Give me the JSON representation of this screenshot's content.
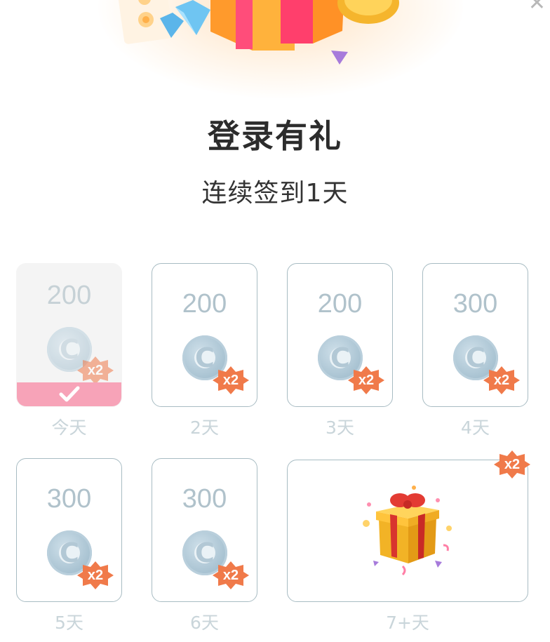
{
  "dialog": {
    "title": "登录有礼",
    "subtitle": "连续签到1天",
    "close_icon": "close-icon"
  },
  "badge_label": "x2",
  "days": [
    {
      "amount": "200",
      "label": "今天",
      "claimed": true
    },
    {
      "amount": "200",
      "label": "2天",
      "claimed": false
    },
    {
      "amount": "200",
      "label": "3天",
      "claimed": false
    },
    {
      "amount": "300",
      "label": "4天",
      "claimed": false
    },
    {
      "amount": "300",
      "label": "5天",
      "claimed": false
    },
    {
      "amount": "300",
      "label": "6天",
      "claimed": false
    }
  ],
  "final_day": {
    "label": "7+天",
    "icon": "gift-box-icon"
  },
  "colors": {
    "claimed_bar": "#f7a3b8",
    "card_border": "#a8bcc3",
    "badge": "#f07a4a",
    "amount": "#b0c2cb"
  }
}
